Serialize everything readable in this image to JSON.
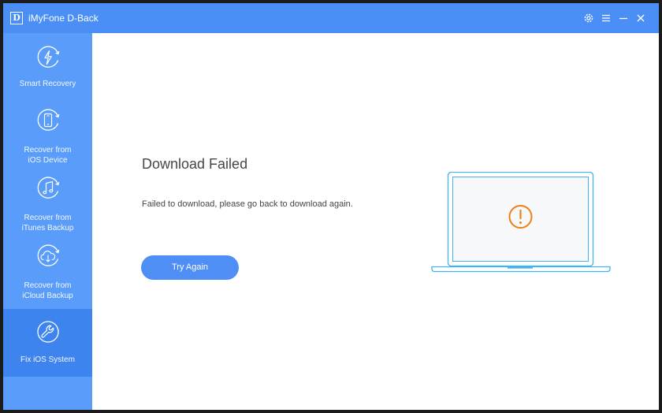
{
  "window": {
    "title": "iMyFone D-Back",
    "logo_letter": "D"
  },
  "titlebar_controls": [
    "gear-icon",
    "menu-icon",
    "minimize-icon",
    "close-icon"
  ],
  "sidebar": {
    "items": [
      {
        "label": "Smart Recovery",
        "icon": "lightning-refresh-icon",
        "active": false
      },
      {
        "label": "Recover from\niOS Device",
        "icon": "phone-refresh-icon",
        "active": false
      },
      {
        "label": "Recover from\niTunes Backup",
        "icon": "music-refresh-icon",
        "active": false
      },
      {
        "label": "Recover from\niCloud Backup",
        "icon": "cloud-download-refresh-icon",
        "active": false
      },
      {
        "label": "Fix iOS System",
        "icon": "wrench-icon",
        "active": true
      }
    ]
  },
  "main": {
    "heading": "Download Failed",
    "message": "Failed to download, please go back to download again.",
    "button_label": "Try Again",
    "illustration": "laptop-warning-icon"
  },
  "colors": {
    "titlebar": "#4b8ef6",
    "sidebar": "#5a9cf9",
    "sidebar_active": "#3d84ee",
    "button": "#4f8ff5",
    "warning": "#f07f17",
    "laptop_outline": "#43b2ee"
  }
}
